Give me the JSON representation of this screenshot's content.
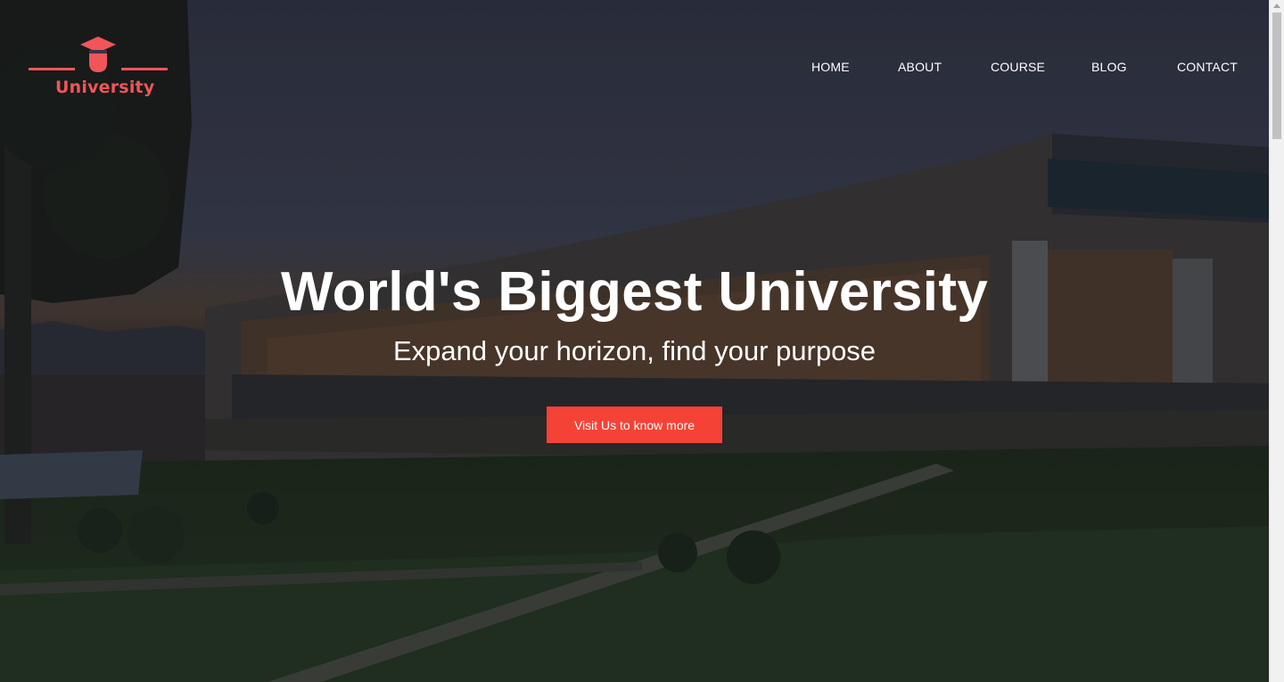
{
  "brand": {
    "name": "University",
    "accent_color": "#f0555a",
    "icon": "graduation-cap-icon"
  },
  "nav": {
    "items": [
      {
        "label": "HOME"
      },
      {
        "label": "ABOUT"
      },
      {
        "label": "COURSE"
      },
      {
        "label": "BLOG"
      },
      {
        "label": "CONTACT"
      }
    ]
  },
  "hero": {
    "title": "World's Biggest University",
    "subtitle": "Expand your horizon, find your purpose",
    "cta_label": "Visit Us to know more",
    "cta_color": "#f44336"
  }
}
